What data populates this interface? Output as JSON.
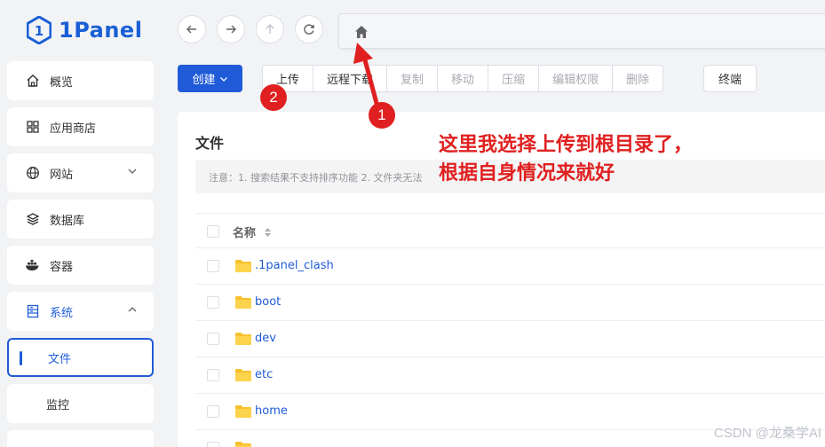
{
  "logo": {
    "text": "1Panel",
    "brand_color": "#1a5fd6"
  },
  "sidebar": {
    "items": [
      {
        "label": "概览",
        "icon": "home-icon"
      },
      {
        "label": "应用商店",
        "icon": "grid-icon"
      },
      {
        "label": "网站",
        "icon": "globe-icon"
      },
      {
        "label": "数据库",
        "icon": "layers-icon"
      },
      {
        "label": "容器",
        "icon": "docker-icon"
      },
      {
        "label": "系统",
        "icon": "server-icon"
      },
      {
        "label": "文件"
      },
      {
        "label": "监控"
      }
    ]
  },
  "toolbar": {
    "nav_icons": [
      "back-icon",
      "forward-icon",
      "up-icon",
      "refresh-icon"
    ],
    "path_icon": "home-icon",
    "create_label": "创建",
    "actions": [
      {
        "label": "上传",
        "enabled": true
      },
      {
        "label": "远程下载",
        "enabled": true
      },
      {
        "label": "复制",
        "enabled": false
      },
      {
        "label": "移动",
        "enabled": false
      },
      {
        "label": "压缩",
        "enabled": false
      },
      {
        "label": "编辑权限",
        "enabled": false
      },
      {
        "label": "删除",
        "enabled": false
      }
    ],
    "terminal_label": "终端"
  },
  "main": {
    "title": "文件",
    "notice": "注意：1. 搜索结果不支持排序功能 2. 文件夹无法",
    "table": {
      "name_header": "名称",
      "rows": [
        {
          "name": ".1panel_clash"
        },
        {
          "name": "boot"
        },
        {
          "name": "dev"
        },
        {
          "name": "etc"
        },
        {
          "name": "home"
        }
      ]
    }
  },
  "annotation": {
    "line1": "这里我选择上传到根目录了，",
    "line2": "根据自身情况来就好",
    "badge1": "1",
    "badge2": "2",
    "color": "#e02020"
  },
  "watermark": "CSDN @龙桑学AI",
  "colors": {
    "accent": "#1f5bd8",
    "folder": "#f7c12c"
  }
}
